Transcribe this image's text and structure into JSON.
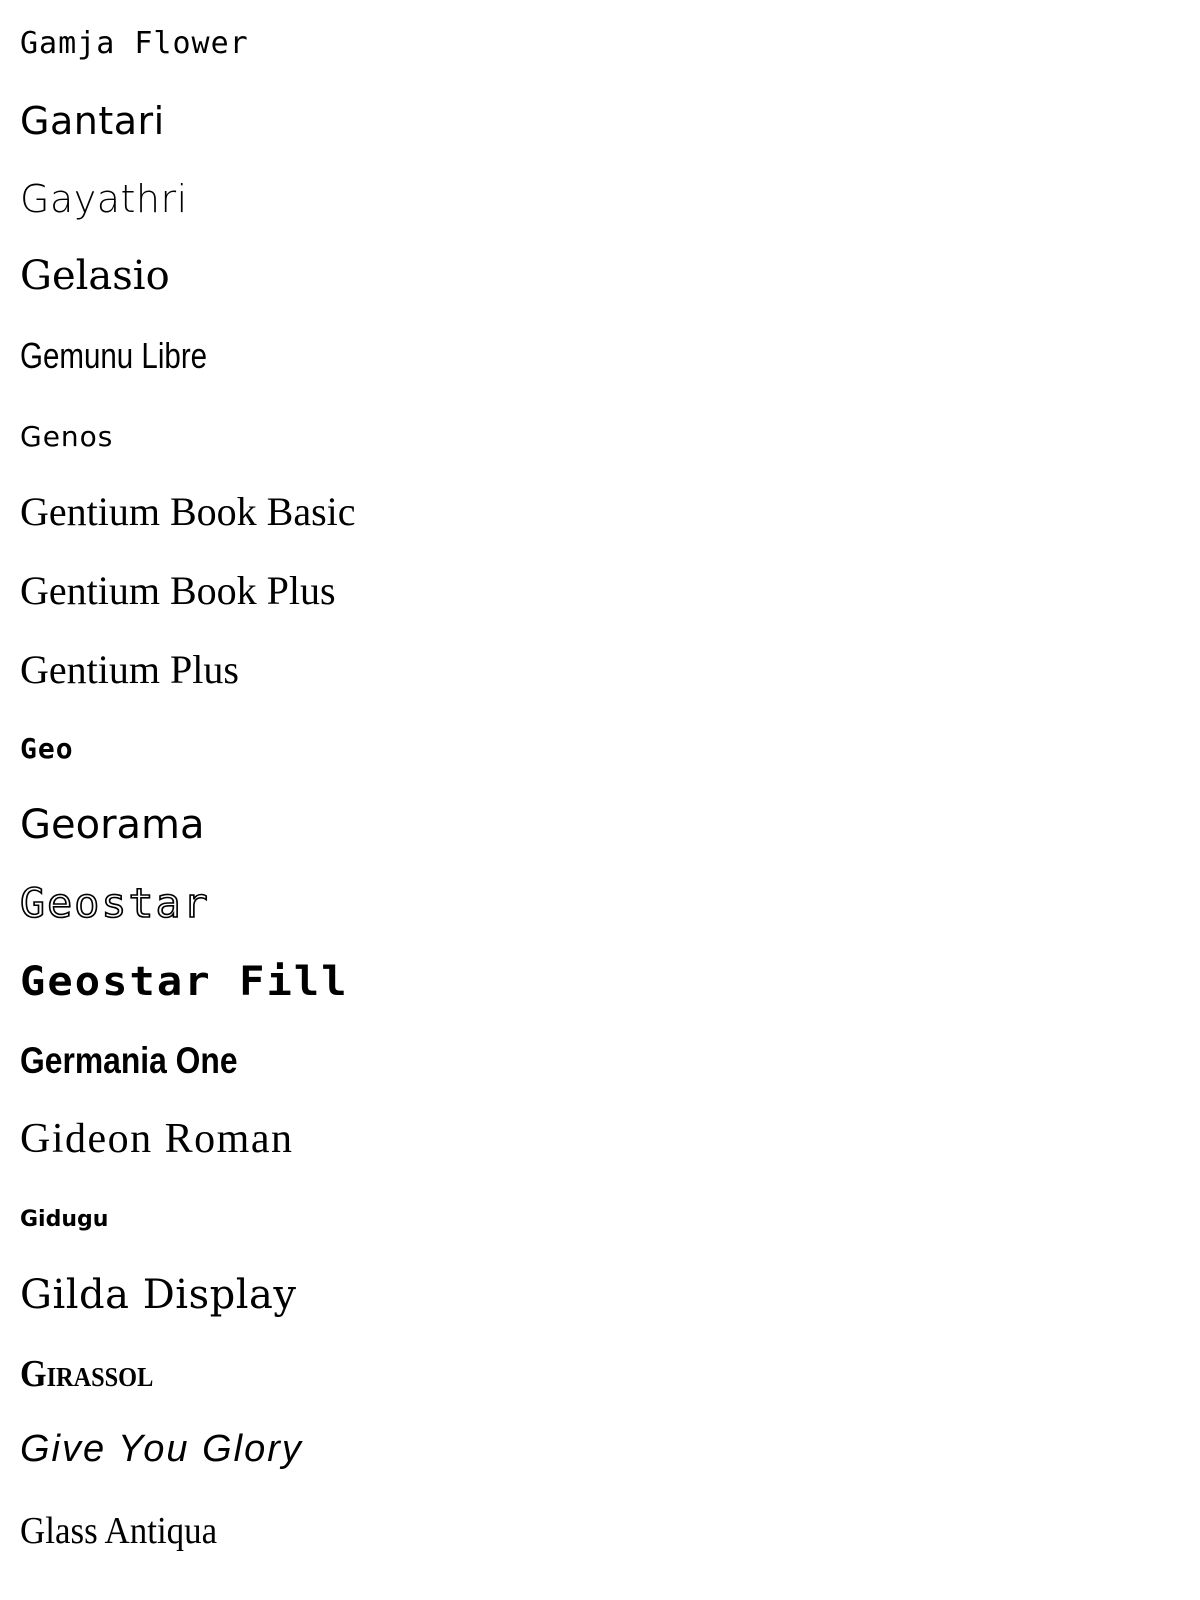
{
  "fonts": [
    "Gamja Flower",
    "Gantari",
    "Gayathri",
    "Gelasio",
    "Gemunu Libre",
    "Genos",
    "Gentium Book Basic",
    "Gentium Book Plus",
    "Gentium Plus",
    "Geo",
    "Georama",
    "Geostar",
    "Geostar Fill",
    "Germania One",
    "Gideon Roman",
    "Gidugu",
    "Gilda Display",
    "Girassol",
    "Give You Glory",
    "Glass Antiqua"
  ]
}
